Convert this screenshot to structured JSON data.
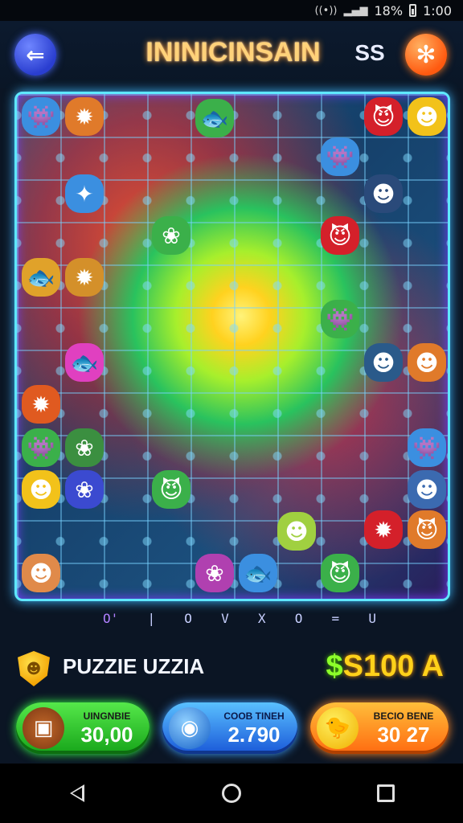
{
  "status_bar": {
    "signal_icon": "wifi-icon",
    "battery_pct": "18%",
    "time": "1:00"
  },
  "header": {
    "back_icon": "back-arrow-icon",
    "title": "ININICINSAIN",
    "score": "SS",
    "settings_icon": "gear-icon"
  },
  "board": {
    "border_color": "#5fe8ff",
    "pieces": [
      {
        "name": "blue-monster",
        "color": "#3b8fe0",
        "glyph": "👾"
      },
      {
        "name": "orange-spiky",
        "color": "#e07a2a",
        "glyph": "✹"
      },
      {
        "name": "green-fish",
        "color": "#3bb04a",
        "glyph": "🐟"
      },
      {
        "name": "red-devil",
        "color": "#d4202a",
        "glyph": "😈"
      },
      {
        "name": "yellow-blob",
        "color": "#f2c21a",
        "glyph": "☻"
      }
    ]
  },
  "hint_row": [
    "O'",
    "|",
    "O",
    "V",
    "X",
    "O",
    "=",
    "U"
  ],
  "info": {
    "shield_icon": "shield-icon",
    "puzzle_name": "PUZZIE UZZIA",
    "prize_dollar": "$",
    "prize_amount": "S100 A"
  },
  "buttons": [
    {
      "small": "UINGNBIE",
      "big": "30,00",
      "icon": "chest-icon"
    },
    {
      "small": "COOB TINEH",
      "big": "2.790",
      "icon": "orb-icon"
    },
    {
      "small": "BECIO BENE",
      "big": "30 27",
      "icon": "chick-icon"
    }
  ],
  "nav": {
    "back": "back-nav-icon",
    "home": "home-nav-icon",
    "recent": "recents-nav-icon"
  }
}
